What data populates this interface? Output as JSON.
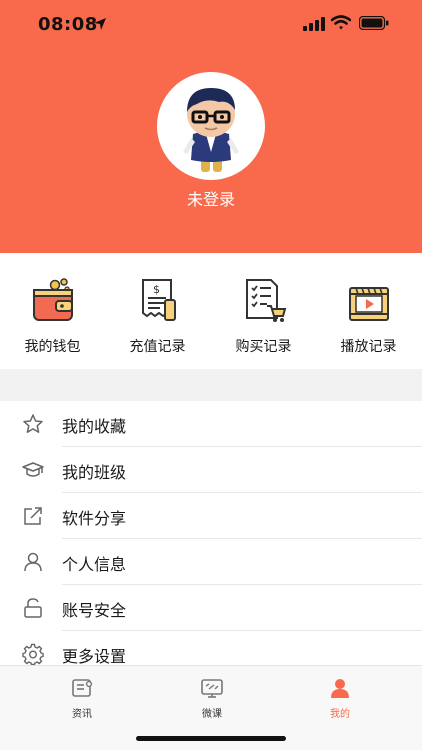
{
  "status_bar": {
    "time": "08:08"
  },
  "profile": {
    "login_status": "未登录"
  },
  "quick_actions": [
    {
      "label": "我的钱包",
      "icon": "wallet-icon"
    },
    {
      "label": "充值记录",
      "icon": "receipt-icon"
    },
    {
      "label": "购买记录",
      "icon": "purchase-list-icon"
    },
    {
      "label": "播放记录",
      "icon": "play-history-icon"
    }
  ],
  "menu": [
    {
      "label": "我的收藏",
      "icon": "star-icon"
    },
    {
      "label": "我的班级",
      "icon": "graduation-cap-icon"
    },
    {
      "label": "软件分享",
      "icon": "share-external-icon"
    },
    {
      "label": "个人信息",
      "icon": "person-icon"
    },
    {
      "label": "账号安全",
      "icon": "lock-icon"
    },
    {
      "label": "更多设置",
      "icon": "gear-icon"
    }
  ],
  "tabbar": [
    {
      "label": "资讯",
      "icon": "news-icon",
      "active": false
    },
    {
      "label": "微课",
      "icon": "video-course-icon",
      "active": false
    },
    {
      "label": "我的",
      "icon": "profile-icon",
      "active": true
    }
  ],
  "colors": {
    "accent": "#f86a4b",
    "divider": "#e8e8e8",
    "section_gap": "#f2f2f2"
  }
}
